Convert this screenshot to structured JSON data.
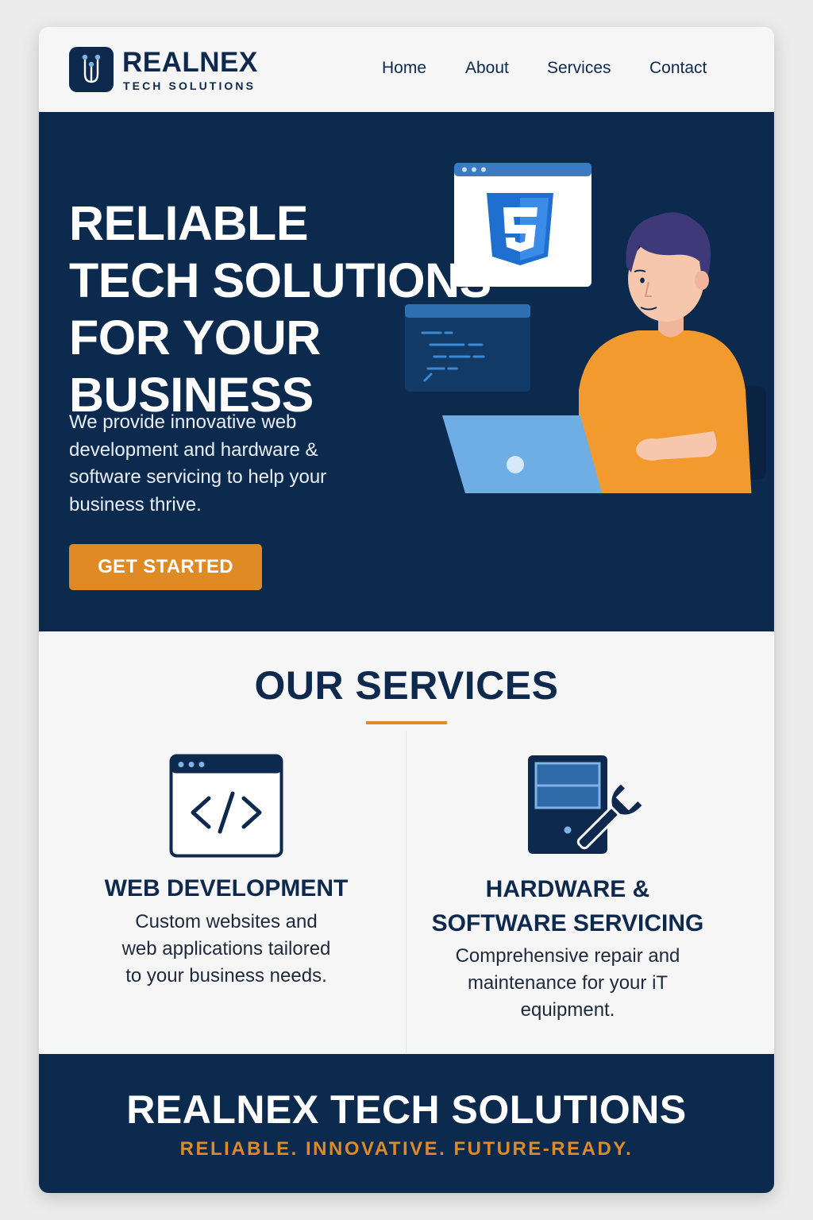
{
  "brand": {
    "name": "REALNEX",
    "subtitle": "TECH SOLUTIONS",
    "navy": "#0c2a4e",
    "accent": "#e08a25",
    "logo_icon": "circuit-node-icon"
  },
  "nav": {
    "items": [
      {
        "label": "Home"
      },
      {
        "label": "About"
      },
      {
        "label": "Services"
      },
      {
        "label": "Contact"
      }
    ]
  },
  "hero": {
    "headline_lines": [
      "RELIABLE",
      "TECH SOLUTIONS",
      "FOR YOUR",
      "BUSINESS"
    ],
    "description": "We provide innovative web development and hardware & software servicing to help your business thrive.",
    "cta_label": "GET STARTED",
    "illustration": "developer-at-laptop-illustration"
  },
  "services": {
    "title": "OUR SERVICES",
    "items": [
      {
        "icon": "code-window-icon",
        "title_lines": [
          "WEB DEVELOPMENT"
        ],
        "description_lines": [
          "Custom websites and",
          "web applications tailored",
          "to your business needs."
        ]
      },
      {
        "icon": "computer-tower-wrench-icon",
        "title_lines": [
          "HARDWARE &",
          "SOFTWARE SERVICING"
        ],
        "description_lines": [
          "Comprehensive repair and",
          "maintenance for your iT",
          "equipment."
        ]
      }
    ]
  },
  "footer": {
    "title": "REALNEX TECH SOLUTIONS",
    "tagline": "RELIABLE. INNOVATIVE. FUTURE-READY."
  }
}
